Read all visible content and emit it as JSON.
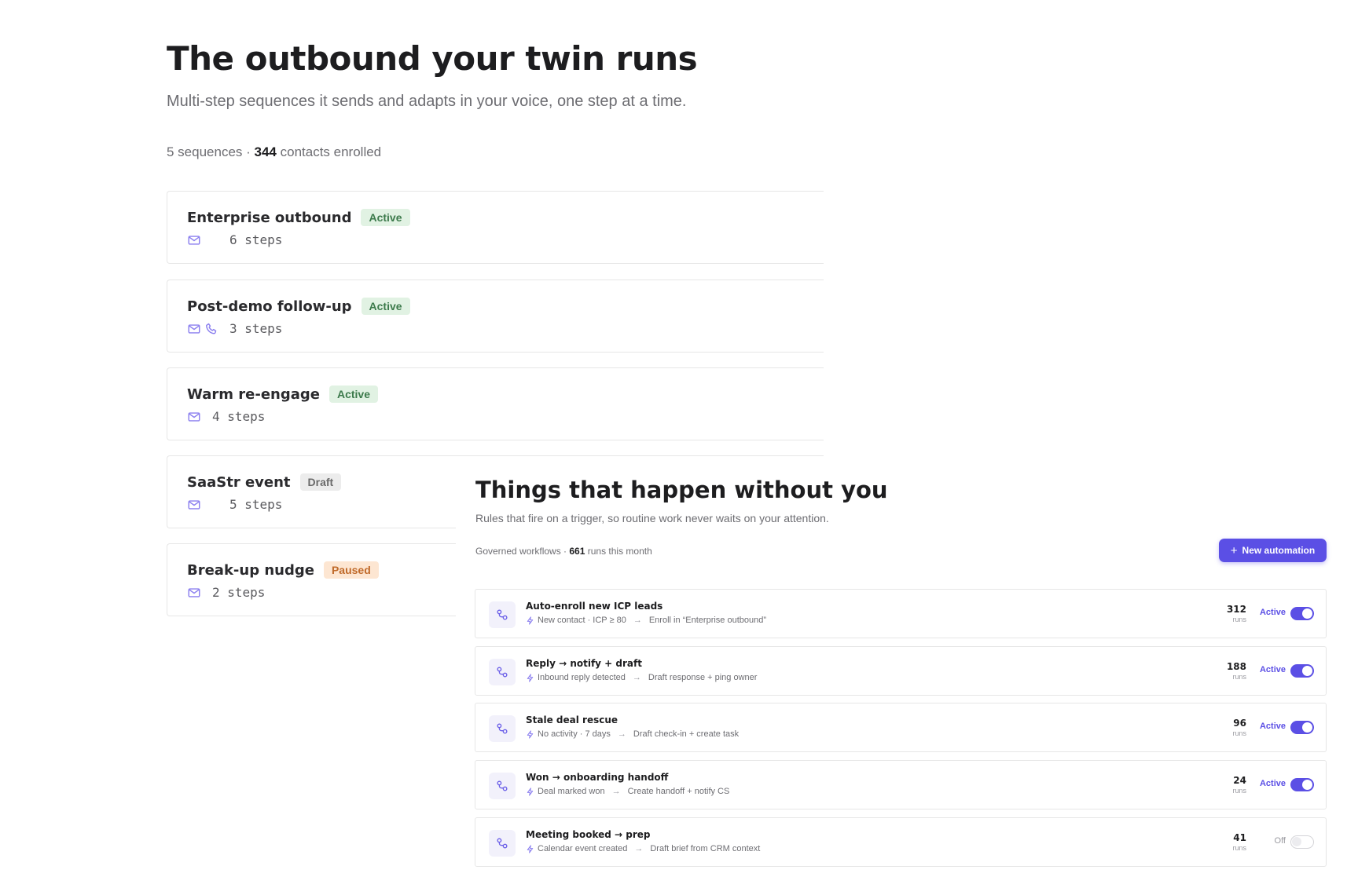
{
  "sequences": {
    "title": "The outbound your twin runs",
    "subtitle": "Multi-step sequences it sends and adapts in your voice, one step at a time.",
    "summary": {
      "count_text": "5 sequences · ",
      "contacts": "344",
      "contacts_suffix": " contacts enrolled"
    },
    "items": [
      {
        "name": "Enterprise outbound",
        "status": "Active",
        "channels": [
          "mail-icon"
        ],
        "steps": "6 steps"
      },
      {
        "name": "Post-demo follow-up",
        "status": "Active",
        "channels": [
          "mail-icon",
          "phone-icon"
        ],
        "steps": "3 steps"
      },
      {
        "name": "Warm re-engage",
        "status": "Active",
        "channels": [
          "mail-icon"
        ],
        "steps": "4 steps"
      },
      {
        "name": "SaaStr event",
        "status": "Draft",
        "channels": [
          "mail-icon"
        ],
        "steps": "5 steps"
      },
      {
        "name": "Break-up nudge",
        "status": "Paused",
        "channels": [
          "mail-icon"
        ],
        "steps": "2 steps"
      }
    ]
  },
  "automations": {
    "title": "Things that happen without you",
    "subtitle": "Rules that fire on a trigger, so routine work never waits on your attention.",
    "summary": {
      "label": "Governed workflows · ",
      "runs": "661",
      "runs_suffix": " runs this month"
    },
    "new_button_label": "New automation",
    "runs_label": "runs",
    "items": [
      {
        "name": "Auto-enroll new ICP leads",
        "trigger": "New contact · ICP ≥ 80",
        "action": "Enroll in “Enterprise outbound”",
        "runs": "312",
        "state": "Active",
        "enabled": true
      },
      {
        "name": "Reply → notify + draft",
        "trigger": "Inbound reply detected",
        "action": "Draft response + ping owner",
        "runs": "188",
        "state": "Active",
        "enabled": true
      },
      {
        "name": "Stale deal rescue",
        "trigger": "No activity · 7 days",
        "action": "Draft check-in + create task",
        "runs": "96",
        "state": "Active",
        "enabled": true
      },
      {
        "name": "Won → onboarding handoff",
        "trigger": "Deal marked won",
        "action": "Create handoff + notify CS",
        "runs": "24",
        "state": "Active",
        "enabled": true
      },
      {
        "name": "Meeting booked → prep",
        "trigger": "Calendar event created",
        "action": "Draft brief from CRM context",
        "runs": "41",
        "state": "Off",
        "enabled": false
      }
    ]
  },
  "colors": {
    "accent": "#5b4fe5",
    "active_badge_bg": "#e1f2e3",
    "active_badge_text": "#3c7a4b",
    "draft_badge_bg": "#ececec",
    "paused_badge_bg": "#fde6d2",
    "paused_badge_text": "#c06a2a",
    "channel_icon": "#8b7fef"
  }
}
